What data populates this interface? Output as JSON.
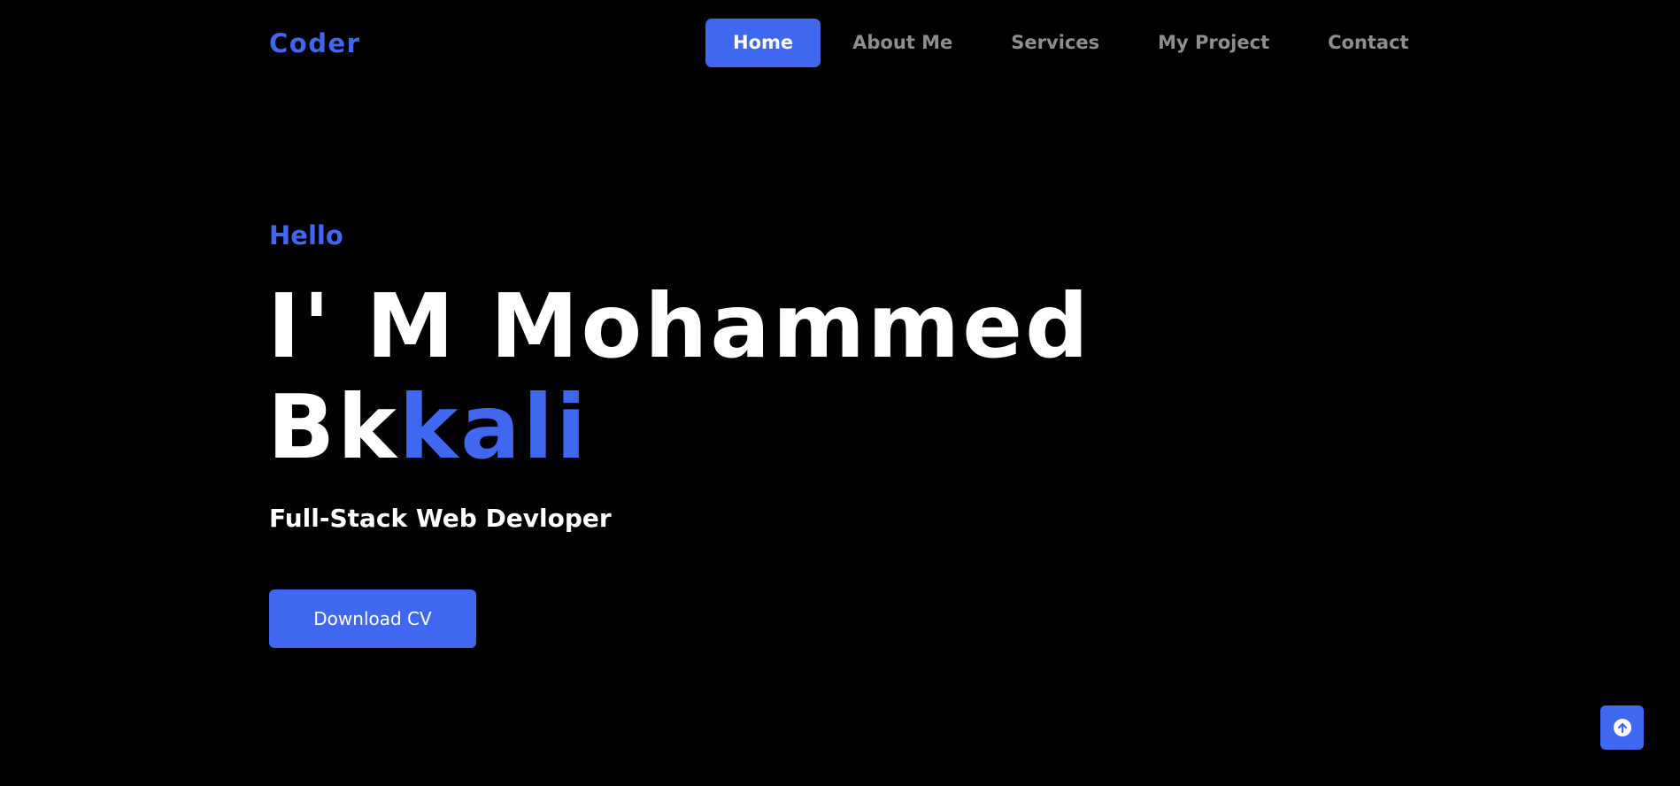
{
  "header": {
    "logo": "Coder",
    "nav": {
      "home": "Home",
      "about": "About Me",
      "services": "Services",
      "project": "My Project",
      "contact": "Contact"
    },
    "active_item": "Home"
  },
  "hero": {
    "greeting": "Hello",
    "headline_line1": "I' M Mohammed",
    "headline_line2_plain": "Bk",
    "headline_line2_accent": "kali",
    "subtitle": "Full-Stack Web Devloper",
    "cta_label": "Download CV"
  },
  "scroll_top": {
    "icon": "arrow-up-circle-icon"
  },
  "colors": {
    "background": "#000000",
    "accent": "#3f67f0",
    "text": "#ffffff",
    "nav_inactive": "#8e8e8e"
  }
}
